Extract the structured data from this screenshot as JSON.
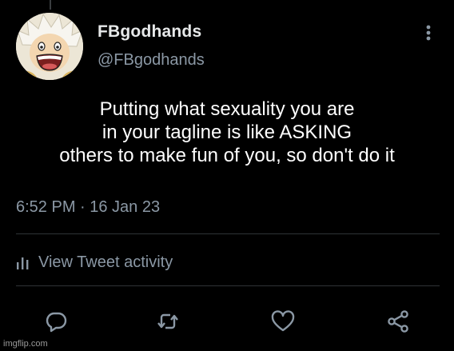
{
  "user": {
    "display_name": "FBgodhands",
    "handle": "@FBgodhands",
    "avatar_icon": "avatar-image"
  },
  "tweet": {
    "lines": [
      "Putting what sexuality you are",
      "in your tagline is like ASKING",
      "others to make fun of you, so don't do it"
    ],
    "timestamp": "6:52 PM · 16 Jan 23"
  },
  "activity": {
    "label": "View Tweet activity",
    "icon": "bar-chart-icon"
  },
  "actions": {
    "reply_icon": "reply-icon",
    "retweet_icon": "retweet-icon",
    "like_icon": "heart-icon",
    "share_icon": "share-icon"
  },
  "menu_icon": "more-vertical-icon",
  "watermark": "imgflip.com",
  "colors": {
    "background": "#000000",
    "primary_text": "#e7e9ea",
    "secondary_text": "#8b98a5",
    "divider": "#2f3336"
  }
}
